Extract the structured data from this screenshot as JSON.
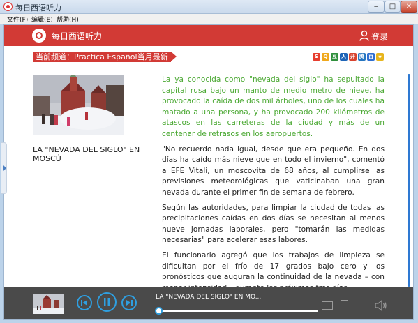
{
  "window": {
    "title": "每日西语听力"
  },
  "menu": [
    "文件(F)",
    "编辑(E)",
    "帮助(H)"
  ],
  "header": {
    "app_name": "每日西语听力",
    "login_label": "登录"
  },
  "channel": {
    "label": "当前频道：Practica Español当月最新"
  },
  "share_icons": [
    {
      "name": "sina-weibo-icon",
      "color": "#e63d2e",
      "glyph": "S"
    },
    {
      "name": "qzone-icon",
      "color": "#f0a81c",
      "glyph": "Q"
    },
    {
      "name": "douban-icon",
      "color": "#2f8f3c",
      "glyph": "豆"
    },
    {
      "name": "renren-icon",
      "color": "#1f65b7",
      "glyph": "人"
    },
    {
      "name": "kaixin-icon",
      "color": "#d8432f",
      "glyph": "开"
    },
    {
      "name": "tencent-weibo-icon",
      "color": "#2676c0",
      "glyph": "腾"
    },
    {
      "name": "baidu-icon",
      "color": "#2f6fd1",
      "glyph": "百"
    },
    {
      "name": "favorite-icon",
      "color": "#e7b51c",
      "glyph": "★"
    }
  ],
  "article": {
    "caption": "LA \"NEVADA DEL SIGLO\" EN MOSCÚ",
    "paragraphs": [
      "La ya conocida como \"nevada del siglo\" ha sepultado la capital rusa bajo un manto de medio metro de nieve, ha provocado la caída de dos mil árboles, uno de los cuales ha matado a una persona, y ha provocado 200 kilómetros de atascos en las carreteras de la ciudad y más de un centenar de retrasos en los aeropuertos.",
      "\"No recuerdo nada igual, desde que era pequeño. En dos días ha caído más nieve que en todo el invierno\", comentó a EFE Vitali, un moscovita de 68 años, al cumplirse las previsiones meteorológicas que vaticinaban una gran nevada durante el primer fin de semana de febrero.",
      "Según las autoridades, para limpiar la ciudad de todas las precipitaciones caídas en dos días se necesitan al menos nueve jornadas laborales, pero \"tomarán las medidas necesarias\" para acelerar esas labores.",
      "El funcionario agregó que los trabajos de limpieza se dificultan por el frío de 17 grados bajo cero y los pronósticos que auguran la continuidad de la nevada – con menor intensidad – durante los próximos tres días."
    ]
  },
  "player": {
    "now_playing": "LA \"NEVADA DEL SIGLO\" EN MO...",
    "progress": 0.0
  },
  "colors": {
    "brand_red": "#d23a35",
    "lead_green": "#4aa832",
    "accent_blue": "#2f9fe0",
    "player_bg": "#4a4a4a"
  }
}
